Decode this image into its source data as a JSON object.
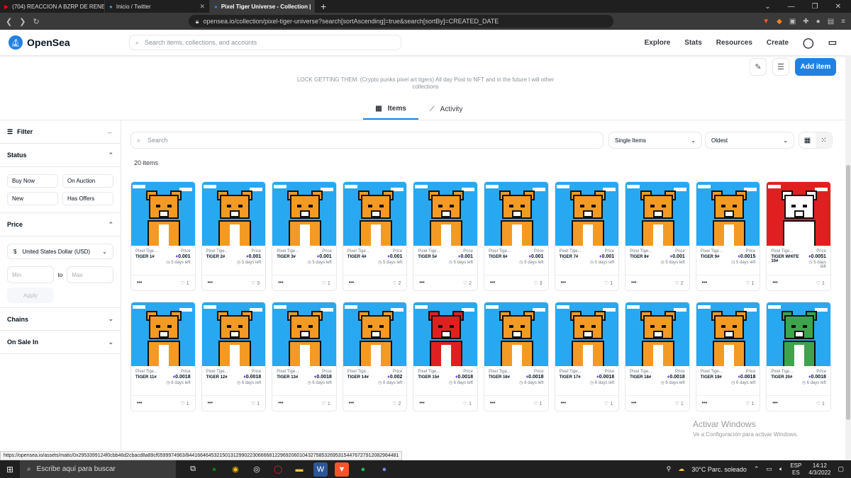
{
  "browser": {
    "tabs": [
      {
        "title": "(704) REACCION A BZRP DE RENE"
      },
      {
        "title": "Inicio / Twitter"
      },
      {
        "title": "Pixel Tiger Universe - Collection |"
      }
    ],
    "url": "opensea.io/collection/pixel-tiger-universe?search[sortAscending]=true&search[sortBy]=CREATED_DATE"
  },
  "header": {
    "brand": "OpenSea",
    "search_placeholder": "Search items, collections, and accounts",
    "nav": [
      "Explore",
      "Stats",
      "Resources",
      "Create"
    ]
  },
  "collection": {
    "description": "LOCK GETTING THEM. (Crypto punks pixel art tigers) All day Post to NFT and in the future I will other collections",
    "add_item": "Add item"
  },
  "view_tabs": [
    {
      "label": "Items"
    },
    {
      "label": "Activity"
    }
  ],
  "sidebar": {
    "filter": "Filter",
    "status": "Status",
    "status_chips": [
      "Buy Now",
      "On Auction",
      "New",
      "Has Offers"
    ],
    "price": "Price",
    "currency": "United States Dollar (USD)",
    "currency_symbol": "$",
    "min_placeholder": "Min",
    "to": "to",
    "max_placeholder": "Max",
    "apply": "Apply",
    "chains": "Chains",
    "on_sale_in": "On Sale In"
  },
  "content": {
    "search_placeholder": "Search",
    "type_filter": "Single Items",
    "sort": "Oldest",
    "count": "20 items"
  },
  "price_label": "Price",
  "items": [
    {
      "collection": "Pixel Tige...",
      "name": "TIGER 1#",
      "price": "0.001",
      "time": "5 days left",
      "likes": "1",
      "color": "#f39a24"
    },
    {
      "collection": "Pixel Tige...",
      "name": "TIGER 2#",
      "price": "0.001",
      "time": "5 days left",
      "likes": "3",
      "color": "#f39a24"
    },
    {
      "collection": "Pixel Tige...",
      "name": "TIGER 3#",
      "price": "0.001",
      "time": "5 days left",
      "likes": "1",
      "color": "#f39a24"
    },
    {
      "collection": "Pixel Tige...",
      "name": "TIGER 4#",
      "price": "0.001",
      "time": "5 days left",
      "likes": "2",
      "color": "#f39a24"
    },
    {
      "collection": "Pixel Tige...",
      "name": "TIGER 5#",
      "price": "0.001",
      "time": "5 days left",
      "likes": "2",
      "color": "#f39a24"
    },
    {
      "collection": "Pixel Tige...",
      "name": "TIGER 6#",
      "price": "0.001",
      "time": "5 days left",
      "likes": "3",
      "color": "#f39a24"
    },
    {
      "collection": "Pixel Tige...",
      "name": "TIGER 7#",
      "price": "0.001",
      "time": "5 days left",
      "likes": "1",
      "color": "#f39a24"
    },
    {
      "collection": "Pixel Tige...",
      "name": "TIGER 8#",
      "price": "0.001",
      "time": "5 days left",
      "likes": "2",
      "color": "#f39a24"
    },
    {
      "collection": "Pixel Tige...",
      "name": "TIGER 9#",
      "price": "0.0015",
      "time": "5 days left",
      "likes": "1",
      "color": "#f39a24"
    },
    {
      "collection": "Pixel Tige...",
      "name": "TIGER WHITE 10#",
      "price": "0.0051",
      "time": "5 days left",
      "likes": "1",
      "color": "#ffffff"
    },
    {
      "collection": "Pixel Tige...",
      "name": "TIGER 11#",
      "price": "0.0018",
      "time": "6 days left",
      "likes": "1",
      "color": "#f39a24"
    },
    {
      "collection": "Pixel Tige...",
      "name": "TIGER 12#",
      "price": "0.0018",
      "time": "6 days left",
      "likes": "1",
      "color": "#f39a24"
    },
    {
      "collection": "Pixel Tige...",
      "name": "TIGER 13#",
      "price": "0.0018",
      "time": "6 days left",
      "likes": "1",
      "color": "#f39a24"
    },
    {
      "collection": "Pixel Tige...",
      "name": "TIGER 14#",
      "price": "0.002",
      "time": "6 days left",
      "likes": "2",
      "color": "#f39a24"
    },
    {
      "collection": "Pixel Tige...",
      "name": "TIGER 15#",
      "price": "0.0018",
      "time": "6 days left",
      "likes": "1",
      "color": "#e02020"
    },
    {
      "collection": "Pixel Tige...",
      "name": "TIGER 16#",
      "price": "0.0018",
      "time": "6 days left",
      "likes": "1",
      "color": "#f39a24"
    },
    {
      "collection": "Pixel Tige...",
      "name": "TIGER 17#",
      "price": "0.0018",
      "time": "6 days left",
      "likes": "1",
      "color": "#f39a24"
    },
    {
      "collection": "Pixel Tige...",
      "name": "TIGER 18#",
      "price": "0.0018",
      "time": "6 days left",
      "likes": "1",
      "color": "#f39a24"
    },
    {
      "collection": "Pixel Tige...",
      "name": "TIGER 19#",
      "price": "0.0018",
      "time": "6 days left",
      "likes": "1",
      "color": "#f39a24"
    },
    {
      "collection": "Pixel Tige...",
      "name": "TIGER 20#",
      "price": "0.0018",
      "time": "6 days left",
      "likes": "1",
      "color": "#3fa34d"
    }
  ],
  "status_url": "https://opensea.io/assets/matic/0x2953399124f0cbb46d2cbacd8a89cf0599974963/84416646453215013129902230666681229692060104327585326953154476727912082964481",
  "watermark": {
    "line1": "Activar Windows",
    "line2": "Ve a Configuración para activar Windows."
  },
  "taskbar": {
    "search": "Escribe aquí para buscar",
    "weather": "30°C  Parc. soleado",
    "lang1": "ESP",
    "lang2": "ES",
    "time": "14:12",
    "date": "4/3/2022"
  }
}
